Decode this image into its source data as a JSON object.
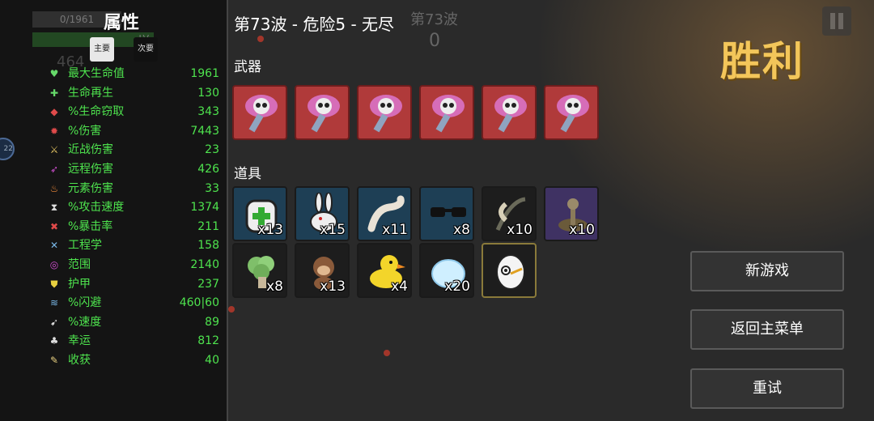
{
  "ghost": {
    "hp": "0/1961",
    "lv": "LV",
    "money": "464",
    "wave": "第73波",
    "zero": "0"
  },
  "stats": {
    "title": "属性",
    "tab_primary": "主要",
    "tab_secondary": "次要",
    "rows": [
      {
        "name": "最大生命值",
        "value": "1961",
        "icon": "heart-icon",
        "color": "#66d96a",
        "glyph": "♥"
      },
      {
        "name": "生命再生",
        "value": "130",
        "icon": "regen-icon",
        "color": "#66d96a",
        "glyph": "✚"
      },
      {
        "name": "%生命窃取",
        "value": "343",
        "icon": "lifesteal-icon",
        "color": "#e04a4a",
        "glyph": "◆"
      },
      {
        "name": "%伤害",
        "value": "7443",
        "icon": "damage-icon",
        "color": "#e04a4a",
        "glyph": "✹"
      },
      {
        "name": "近战伤害",
        "value": "23",
        "icon": "sword-icon",
        "color": "#e0c060",
        "glyph": "⚔"
      },
      {
        "name": "远程伤害",
        "value": "426",
        "icon": "bow-icon",
        "color": "#d24fd2",
        "glyph": "➶"
      },
      {
        "name": "元素伤害",
        "value": "33",
        "icon": "fire-icon",
        "color": "#f08a3a",
        "glyph": "♨"
      },
      {
        "name": "%攻击速度",
        "value": "1374",
        "icon": "hourglass-icon",
        "color": "#dddddd",
        "glyph": "⧗"
      },
      {
        "name": "%暴击率",
        "value": "211",
        "icon": "crit-icon",
        "color": "#e04a4a",
        "glyph": "✖"
      },
      {
        "name": "工程学",
        "value": "158",
        "icon": "wrench-icon",
        "color": "#7ab8e8",
        "glyph": "✕"
      },
      {
        "name": "范围",
        "value": "2140",
        "icon": "range-icon",
        "color": "#d24fd2",
        "glyph": "◎"
      },
      {
        "name": "护甲",
        "value": "237",
        "icon": "shield-icon",
        "color": "#e8d040",
        "glyph": "⛊"
      },
      {
        "name": "%闪避",
        "value": "460|60",
        "icon": "dodge-icon",
        "color": "#7ab8e8",
        "glyph": "≋"
      },
      {
        "name": "%速度",
        "value": "89",
        "icon": "boot-icon",
        "color": "#dddddd",
        "glyph": "➹"
      },
      {
        "name": "幸运",
        "value": "812",
        "icon": "clover-icon",
        "color": "#dddddd",
        "glyph": "♣"
      },
      {
        "name": "收获",
        "value": "40",
        "icon": "harvest-icon",
        "color": "#e8d080",
        "glyph": "✎"
      }
    ],
    "side_knob": "22"
  },
  "header": {
    "wave_title": "第73波 - 危险5 - 无尽"
  },
  "weapons": {
    "label": "武器",
    "items": [
      {
        "name": "skull-axe"
      },
      {
        "name": "skull-axe"
      },
      {
        "name": "skull-axe"
      },
      {
        "name": "skull-axe"
      },
      {
        "name": "skull-axe"
      },
      {
        "name": "skull-axe"
      }
    ]
  },
  "items": {
    "label": "道具",
    "row1": [
      {
        "icon": "medkit-backpack-icon",
        "qty": "x13",
        "tier": "blue"
      },
      {
        "icon": "rabbit-icon",
        "qty": "x15",
        "tier": "blue"
      },
      {
        "icon": "worm-icon",
        "qty": "x11",
        "tier": "blue"
      },
      {
        "icon": "sunglasses-icon",
        "qty": "x8",
        "tier": "blue"
      },
      {
        "icon": "scythe-icon",
        "qty": "x10",
        "tier": "gray"
      },
      {
        "icon": "joystick-icon",
        "qty": "x10",
        "tier": "purple"
      }
    ],
    "row2": [
      {
        "icon": "broccoli-icon",
        "qty": "x8",
        "tier": "gray"
      },
      {
        "icon": "monkey-icon",
        "qty": "x13",
        "tier": "gray"
      },
      {
        "icon": "duck-icon",
        "qty": "x4",
        "tier": "gray"
      },
      {
        "icon": "ice-blob-icon",
        "qty": "x20",
        "tier": "gray"
      },
      {
        "icon": "egg-eye-icon",
        "qty": "",
        "tier": "gold"
      }
    ]
  },
  "result": {
    "label": "胜利",
    "color": "#f3c65a"
  },
  "buttons": {
    "new_game": "新游戏",
    "main_menu": "返回主菜单",
    "retry": "重试"
  }
}
